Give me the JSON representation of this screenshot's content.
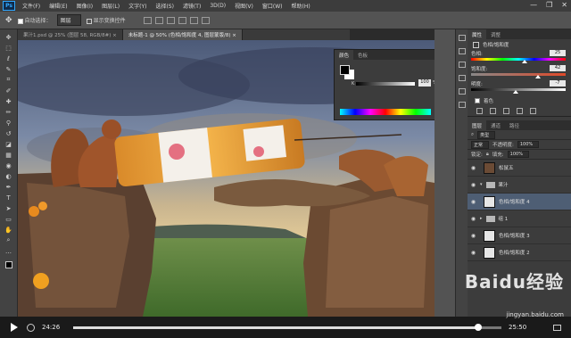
{
  "app": {
    "logo": "Ps"
  },
  "menubar": {
    "items": [
      "文件(F)",
      "编辑(E)",
      "图像(I)",
      "图层(L)",
      "文字(Y)",
      "选择(S)",
      "滤镜(T)",
      "3D(D)",
      "视图(V)",
      "窗口(W)",
      "帮助(H)"
    ],
    "window_controls": [
      "—",
      "❐",
      "✕"
    ]
  },
  "options_bar": {
    "auto_select_label": "自动选择：",
    "auto_select_value": "图层",
    "show_transform_label": "显示变换控件"
  },
  "doc_tabs": [
    {
      "label": "果汁1.psd @ 25% (图层 58, RGB/8#) ×",
      "active": false
    },
    {
      "label": "未标题-1 @ 50% (色相/饱和度 4, 图层蒙版/8) ×",
      "active": true
    }
  ],
  "color_panel": {
    "tabs": [
      "颜色",
      "色板"
    ],
    "channel_label": "K",
    "value": "100",
    "unit": "%"
  },
  "properties": {
    "tabs": [
      "属性",
      "调整"
    ],
    "header": "色相/饱和度",
    "rows": [
      {
        "label": "色相:",
        "value": "25",
        "fraction": 0.57
      },
      {
        "label": "饱和度:",
        "value": "42",
        "fraction": 0.71
      },
      {
        "label": "明度:",
        "value": "-7",
        "fraction": 0.47
      }
    ],
    "colorize_label": "着色"
  },
  "layers": {
    "tabs": [
      "图层",
      "通道",
      "路径"
    ],
    "filter_label": "类型",
    "blend_mode": "正常",
    "opacity_label": "不透明度:",
    "opacity": "100%",
    "lock_label": "锁定:",
    "fill_label": "填充:",
    "fill": "100%",
    "items": [
      {
        "name": "松鼠五",
        "thumb": "dark",
        "selected": false,
        "chev": ""
      },
      {
        "name": "果汁",
        "thumb": "",
        "selected": false,
        "chev": "▾"
      },
      {
        "name": "色相/饱和度 4",
        "thumb": "light",
        "selected": true,
        "chev": ""
      },
      {
        "name": "组 1",
        "thumb": "",
        "selected": false,
        "chev": "▸"
      },
      {
        "name": "色相/饱和度 3",
        "thumb": "light",
        "selected": false,
        "chev": ""
      },
      {
        "name": "色相/饱和度 2",
        "thumb": "light",
        "selected": false,
        "chev": ""
      }
    ]
  },
  "video": {
    "current_time": "24:26",
    "total_time": "25:50",
    "progress": 0.945
  },
  "watermark": {
    "line1": "Baidu经验",
    "line2": "jingyan.baidu.com"
  }
}
